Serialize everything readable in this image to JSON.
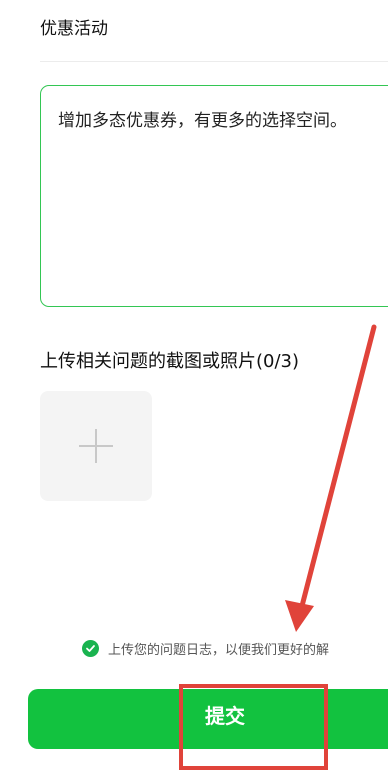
{
  "section": {
    "title": "优惠活动"
  },
  "feedback": {
    "text": "增加多态优惠券，有更多的选择空间。"
  },
  "upload": {
    "title": "上传相关问题的截图或照片(0/3)"
  },
  "consent": {
    "text": "上传您的问题日志，以便我们更好的解"
  },
  "submit": {
    "label": "提交"
  },
  "colors": {
    "accent": "#12c23f",
    "focus_border": "#33c653",
    "annotation": "#e0433a"
  },
  "icons": {
    "add": "plus-icon",
    "consent": "check-circle-icon"
  }
}
